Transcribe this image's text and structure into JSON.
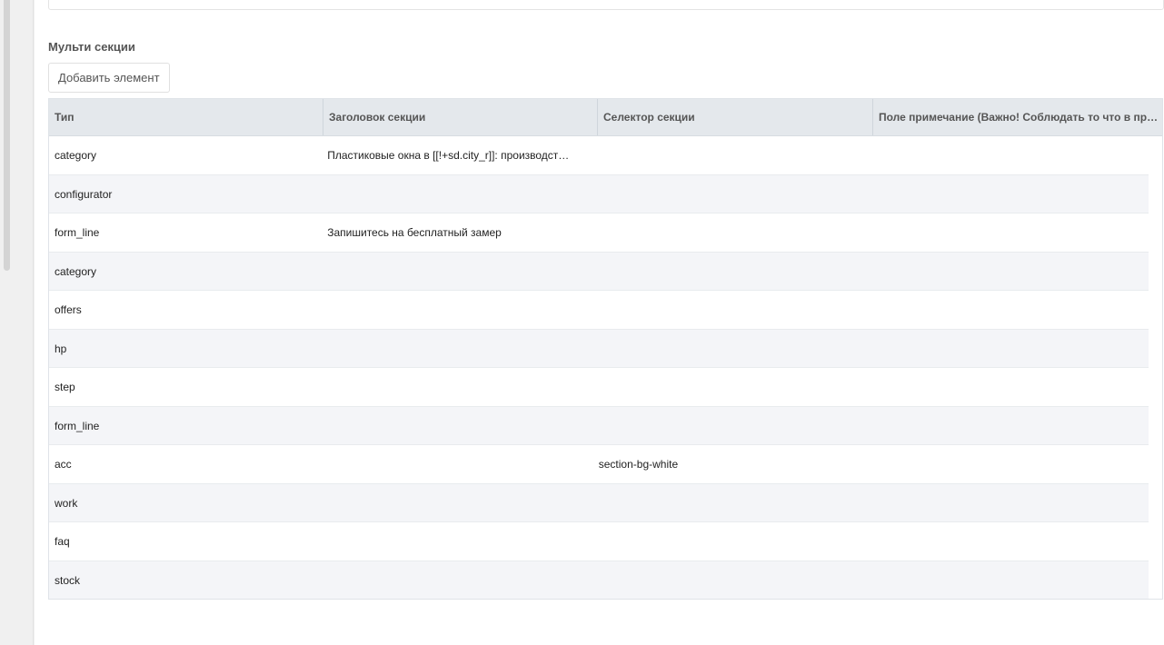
{
  "section": {
    "title": "Мульти секции",
    "add_label": "Добавить элемент"
  },
  "table": {
    "headers": [
      "Тип",
      "Заголовок секции",
      "Селектор секции",
      "Поле примечание (Важно! Соблюдать то что в примечании)"
    ],
    "rows": [
      {
        "type": "category",
        "title": "Пластиковые окна в [[!+sd.city_r]]: производство и установка",
        "selector": "",
        "note": ""
      },
      {
        "type": "configurator",
        "title": "",
        "selector": "",
        "note": ""
      },
      {
        "type": "form_line",
        "title": "Запишитесь на бесплатный замер",
        "selector": "",
        "note": ""
      },
      {
        "type": "category",
        "title": "",
        "selector": "",
        "note": ""
      },
      {
        "type": "offers",
        "title": "",
        "selector": "",
        "note": ""
      },
      {
        "type": "hp",
        "title": "",
        "selector": "",
        "note": ""
      },
      {
        "type": "step",
        "title": "",
        "selector": "",
        "note": ""
      },
      {
        "type": "form_line",
        "title": "",
        "selector": "",
        "note": ""
      },
      {
        "type": "acc",
        "title": "",
        "selector": "section-bg-white",
        "note": ""
      },
      {
        "type": "work",
        "title": "",
        "selector": "",
        "note": ""
      },
      {
        "type": "faq",
        "title": "",
        "selector": "",
        "note": ""
      },
      {
        "type": "stock",
        "title": "",
        "selector": "",
        "note": ""
      }
    ]
  }
}
